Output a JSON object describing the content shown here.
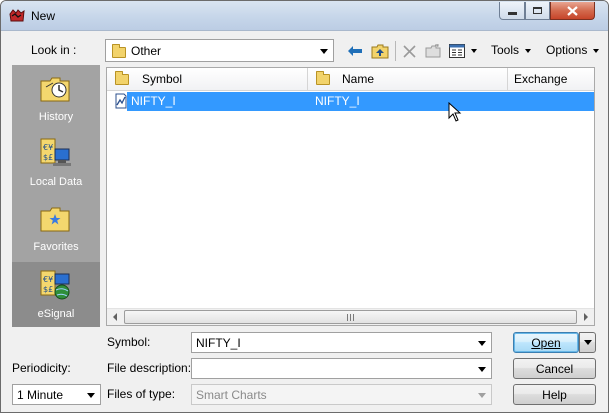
{
  "window": {
    "title": "New",
    "controls": {
      "minimize": "minimize",
      "maximize": "maximize",
      "close": "close"
    }
  },
  "toolbar": {
    "look_in_label": "Look in :",
    "look_in_value": "Other",
    "tools_label": "Tools",
    "options_label": "Options"
  },
  "places": [
    {
      "label": "History",
      "icon": "history-icon"
    },
    {
      "label": "Local Data",
      "icon": "local-data-icon"
    },
    {
      "label": "Favorites",
      "icon": "favorites-icon"
    },
    {
      "label": "eSignal",
      "icon": "esignal-icon"
    }
  ],
  "list": {
    "columns": [
      "Symbol",
      "Name",
      "Exchange"
    ],
    "rows": [
      {
        "symbol": "NIFTY_I",
        "name": "NIFTY_I",
        "exchange": "",
        "selected": true
      }
    ]
  },
  "form": {
    "symbol_label": "Symbol:",
    "symbol_value": "NIFTY_I",
    "file_description_label": "File description:",
    "file_description_value": "",
    "files_of_type_label": "Files of type:",
    "files_of_type_value": "Smart Charts",
    "periodicity_label": "Periodicity:",
    "periodicity_value": "1 Minute"
  },
  "buttons": {
    "open": "Open",
    "cancel": "Cancel",
    "help": "Help"
  },
  "colors": {
    "selection": "#3399ff",
    "places_panel": "#a3a3a3",
    "dialog_bg": "#f0f0f0"
  }
}
